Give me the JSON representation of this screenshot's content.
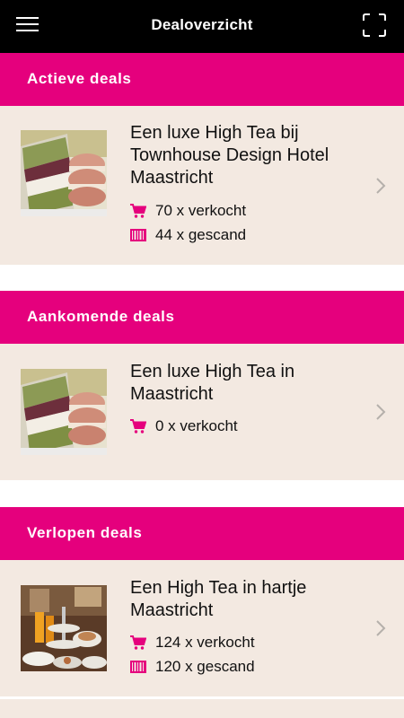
{
  "header": {
    "title": "Dealoverzicht",
    "menu_icon": "hamburger-menu-icon",
    "scan_icon": "scan-frame-icon"
  },
  "colors": {
    "header_bg": "#000000",
    "accent": "#e5007d",
    "card_bg": "#f3e9e1",
    "icon": "#e5007d"
  },
  "sections": [
    {
      "label": "Actieve deals",
      "deals": [
        {
          "title": "Een luxe High Tea bij Townhouse Design Hotel Maastricht",
          "sold": "70 x verkocht",
          "scanned": "44 x gescand"
        }
      ]
    },
    {
      "label": "Aankomende deals",
      "deals": [
        {
          "title": "Een luxe High Tea in Maastricht",
          "sold": "0 x verkocht"
        }
      ]
    },
    {
      "label": "Verlopen deals",
      "deals": [
        {
          "title": "Een High Tea in hartje Maastricht",
          "sold": "124 x verkocht",
          "scanned": "120 x gescand"
        }
      ]
    }
  ]
}
